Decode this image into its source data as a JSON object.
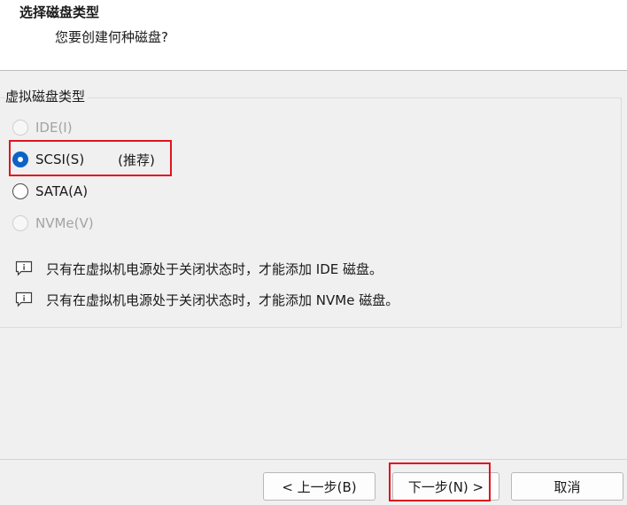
{
  "header": {
    "title": "选择磁盘类型",
    "subtitle": "您要创建何种磁盘?"
  },
  "disk_type_group": {
    "legend": "虚拟磁盘类型",
    "options": [
      {
        "label": "IDE(I)",
        "enabled": false,
        "selected": false
      },
      {
        "label": "SCSI(S)",
        "enabled": true,
        "selected": true,
        "note": "(推荐)"
      },
      {
        "label": "SATA(A)",
        "enabled": true,
        "selected": false
      },
      {
        "label": "NVMe(V)",
        "enabled": false,
        "selected": false
      }
    ]
  },
  "info_messages": [
    {
      "text": "只有在虚拟机电源处于关闭状态时，才能添加 IDE 磁盘。",
      "icon": "info-comment-icon"
    },
    {
      "text": "只有在虚拟机电源处于关闭状态时，才能添加 NVMe 磁盘。",
      "icon": "info-comment-icon"
    }
  ],
  "footer": {
    "back_label": "< 上一步(B)",
    "next_label": "下一步(N) >",
    "cancel_label": "取消"
  },
  "colors": {
    "accent": "#0b63c5",
    "highlight": "#e0141e",
    "background": "#f0f0f0"
  }
}
